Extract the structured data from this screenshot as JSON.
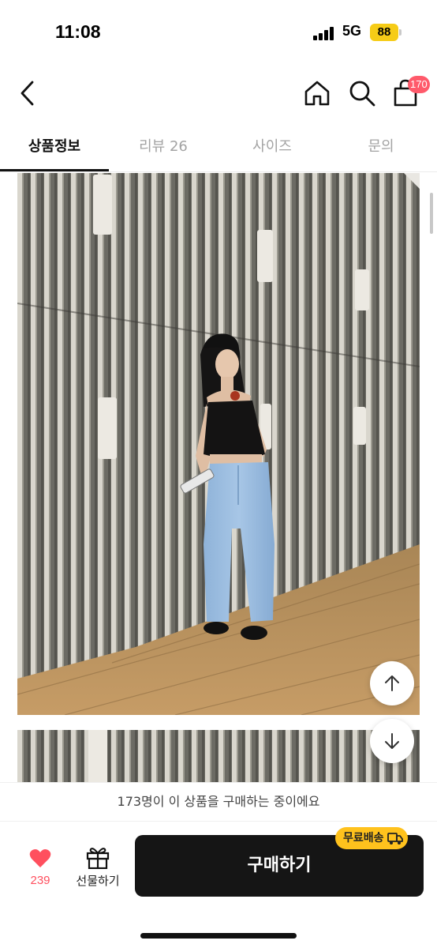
{
  "status_bar": {
    "time": "11:08",
    "network": "5G",
    "battery": "88",
    "battery_color": "#f6cc17"
  },
  "nav": {
    "back_icon": "chevron-left-icon",
    "home_icon": "home-icon",
    "search_icon": "search-icon",
    "cart_icon": "shopping-bag-icon",
    "cart_badge": "170",
    "badge_color": "#ff5a6b"
  },
  "tabs": [
    {
      "label": "상품정보",
      "active": true
    },
    {
      "label": "리뷰 26",
      "active": false
    },
    {
      "label": "사이즈",
      "active": false
    },
    {
      "label": "문의",
      "active": false
    }
  ],
  "floating": {
    "up_icon": "arrow-up-icon",
    "down_icon": "arrow-down-icon"
  },
  "banner": {
    "text": "173명이 이 상품을 구매하는 중이에요"
  },
  "bottom": {
    "like_icon": "heart-icon",
    "like_count": "239",
    "like_color": "#ff4f5e",
    "gift_icon": "gift-icon",
    "gift_label": "선물하기",
    "buy_label": "구매하기",
    "shipping_badge": "무료배송",
    "shipping_icon": "truck-icon",
    "shipping_color": "#ffc21d"
  }
}
